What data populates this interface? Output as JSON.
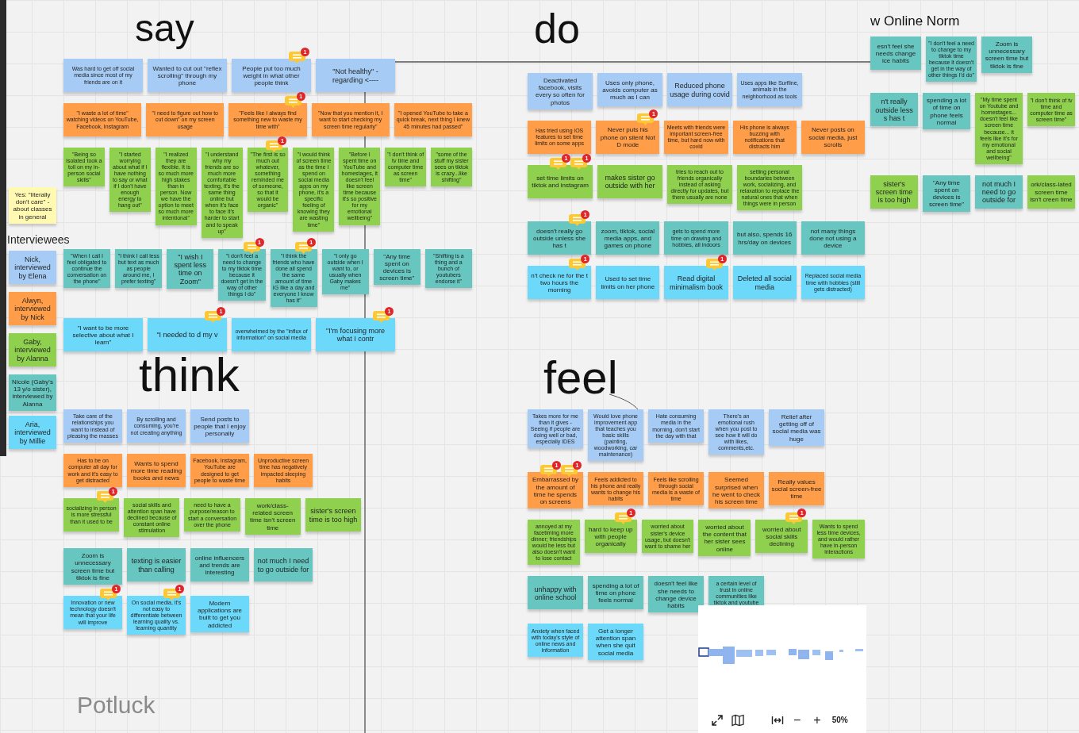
{
  "sections": [
    {
      "title": "say",
      "notes": [
        {
          "text": "Was hard to get off social media since most of my friends are on it",
          "color": "#a6ccf5"
        },
        {
          "text": "Wanted to cut out \"reflex scrolling\" through my phone",
          "color": "#a6ccf5"
        },
        {
          "text": "People put too much weight in what other people think",
          "color": "#a6ccf5",
          "comments": [
            "1"
          ]
        },
        {
          "text": "\"Not healthy\" - regarding <----",
          "color": "#a6ccf5"
        },
        {
          "text": "\"I waste a lot of time\" watching videos on YouTube, Facebook, Instagram",
          "color": "#ff9d48"
        },
        {
          "text": "\"I need to figure out how to cut down\" on my screen usage",
          "color": "#ff9d48"
        },
        {
          "text": "\"Feels like I always find something new to waste my time with\"",
          "color": "#ff9d48",
          "comments": [
            "1"
          ]
        },
        {
          "text": "\"Now that you mention it, I want to start checking my screen time regularly\"",
          "color": "#ff9d48"
        },
        {
          "text": "\"I opened YouTube to take a quick break, next thing I knew 45 minutes had passed\"",
          "color": "#ff9d48"
        },
        {
          "text": "\"Being so isolated took a toll on my in-person social skills\"",
          "color": "#8fd14f"
        },
        {
          "text": "\"I started worrying about what if I have nothing to say or what if I don't have enough energy to hang out\"",
          "color": "#8fd14f"
        },
        {
          "text": "\"I realized they are flexible. It is so much more high stakes than in person. Now we have the option to meet so much more intentional\"",
          "color": "#8fd14f"
        },
        {
          "text": "\"I understand why my friends are so much more comfortable texting, it's the same thing online but when it's face to face it's harder to start and to speak up\"",
          "color": "#8fd14f"
        },
        {
          "text": "\"The first is so much out whatever, something reminded me of someone, so that it would be organic\"",
          "color": "#8fd14f",
          "comments": [
            "1"
          ]
        },
        {
          "text": "\"I would think of screen time as the time I spend on social media apps on my phone, it's a specific feeling of knowing they are wasting time\"",
          "color": "#8fd14f"
        },
        {
          "text": "\"Before I spent time on YouTube and homestages, it doesn't feel like screen time because it's so positive for my emotional wellbeing\"",
          "color": "#8fd14f"
        },
        {
          "text": "\"I don't think of tv time and computer time as screen time\"",
          "color": "#8fd14f"
        },
        {
          "text": "\"some of the stuff my sister sees on tiktok is crazy...like shifting\"",
          "color": "#8fd14f"
        },
        {
          "text": "\"When I call I feel obligated to continue the conversation on the phone\"",
          "color": "#67c6c0"
        },
        {
          "text": "\"I think I call less but text as much as people around me, I prefer texting\"",
          "color": "#67c6c0"
        },
        {
          "text": "\"I wish I spent less time on Zoom\"",
          "color": "#67c6c0"
        },
        {
          "text": "\"I don't feel a need to change to my tiktok time because it doesn't get in the way of other things I do\"",
          "color": "#67c6c0",
          "comments": [
            "1"
          ]
        },
        {
          "text": "\"I think the friends who have done all spend the same amount of time IG like a day and everyone I know has it\"",
          "color": "#67c6c0",
          "comments": [
            "1"
          ]
        },
        {
          "text": "\"I only go outside when I want to, or usually when Gaby makes me\"",
          "color": "#67c6c0"
        },
        {
          "text": "\"Any time spent on devices is screen time\"",
          "color": "#67c6c0"
        },
        {
          "text": "\"Shifting is a thing and a bunch of youtubers endorse it\"",
          "color": "#67c6c0"
        },
        {
          "text": "\"I want to be more selective about what I learn\"",
          "color": "#6cd8fa"
        },
        {
          "text": "\"I needed to d my v",
          "color": "#6cd8fa",
          "comments": [
            "1"
          ]
        },
        {
          "text": "overwhelmed by the \"influx of information\" on social media",
          "color": "#6cd8fa"
        },
        {
          "text": "\"I'm focusing more what I contr",
          "color": "#6cd8fa",
          "comments": [
            "1"
          ]
        }
      ]
    },
    {
      "title": "do",
      "notes": [
        {
          "text": "Deactivated facebook, visits every so often for photos",
          "color": "#a6ccf5"
        },
        {
          "text": "Uses only phone, avoids computer as much as I can",
          "color": "#a6ccf5"
        },
        {
          "text": "Reduced phone usage during covid",
          "color": "#a6ccf5"
        },
        {
          "text": "Uses apps like Surfline, animals in the neighborhood as tools",
          "color": "#a6ccf5"
        },
        {
          "text": "Has tried using iOS features to set time limits on some apps",
          "color": "#ff9d48"
        },
        {
          "text": "Never puts his phone on silent Not D mode",
          "color": "#ff9d48",
          "comments": [
            "1"
          ]
        },
        {
          "text": "Meets with friends were important screen-free time, but hard now with covid",
          "color": "#ff9d48"
        },
        {
          "text": "His phone is always buzzing with notifications that distracts him",
          "color": "#ff9d48"
        },
        {
          "text": "Never posts on social media, just scrolls",
          "color": "#ff9d48"
        },
        {
          "text": "set time limits on tiktok and instagram",
          "color": "#8fd14f",
          "comments": [
            "1",
            "1"
          ]
        },
        {
          "text": "makes sister go outside with her",
          "color": "#8fd14f"
        },
        {
          "text": "tries to reach out to friends organically instead of asking directly for updates, but there usually are none",
          "color": "#8fd14f"
        },
        {
          "text": "setting personal boundaries between work, socializing, and relaxation to replace the natural ones that when things were in person",
          "color": "#8fd14f"
        },
        {
          "text": "doesn't really go outside unless she has t",
          "color": "#67c6c0",
          "comments": [
            "1"
          ]
        },
        {
          "text": "zoom, tiktok, social media apps, and games on phone",
          "color": "#67c6c0"
        },
        {
          "text": "gets to spend more time on drawing and hobbies, all indoors",
          "color": "#67c6c0"
        },
        {
          "text": "but also, spends 16 hrs/day on devices",
          "color": "#67c6c0"
        },
        {
          "text": "not many things done not using a device",
          "color": "#67c6c0"
        },
        {
          "text": "n't check ne for the t two hours the morning",
          "color": "#6cd8fa",
          "comments": [
            "1"
          ]
        },
        {
          "text": "Used to set time limits on her phone",
          "color": "#6cd8fa"
        },
        {
          "text": "Read digital minimalism book",
          "color": "#6cd8fa",
          "comments": [
            "1"
          ]
        },
        {
          "text": "Deleted all social media",
          "color": "#6cd8fa"
        },
        {
          "text": "Replaced social media time with hobbies (still gets distracted)",
          "color": "#6cd8fa"
        }
      ]
    },
    {
      "title": "w Online Norm",
      "notes": [
        {
          "text": "esn't feel she needs change ice habits",
          "color": "#67c6c0"
        },
        {
          "text": "\"I don't feel a need to change to my tiktok time because it doesn't get in the way of other things I'd do\"",
          "color": "#67c6c0"
        },
        {
          "text": "Zoom is unnecessary screen time but tiktok is fine",
          "color": "#67c6c0"
        },
        {
          "text": "n't really outside less s has t",
          "color": "#67c6c0"
        },
        {
          "text": "spending a lot of time on phone feels normal",
          "color": "#67c6c0"
        },
        {
          "text": "\"My time spent on Youtube and homestages... doesn't feel like screen time because... it feels like it's for my emotional and social wellbeing\"",
          "color": "#8fd14f"
        },
        {
          "text": "\"I don't think of tv time and computer time as screen time\"",
          "color": "#8fd14f"
        },
        {
          "text": "sister's screen time is too high",
          "color": "#8fd14f"
        },
        {
          "text": "\"Any time spent on devices is screen time\"",
          "color": "#67c6c0"
        },
        {
          "text": "not much I need to go outside for",
          "color": "#67c6c0"
        },
        {
          "text": "ork/class-lated screen time isn't creen time",
          "color": "#8fd14f"
        }
      ]
    },
    {
      "title": "think",
      "notes": [
        {
          "text": "Take care of the relationships you want to instead of pleasing the masses",
          "color": "#a6ccf5"
        },
        {
          "text": "By scrolling and consuming, you're not creating anything",
          "color": "#a6ccf5"
        },
        {
          "text": "Send posts to people that I enjoy personally",
          "color": "#a6ccf5"
        },
        {
          "text": "Has to be on computer all day for work and it's easy to get distracted",
          "color": "#ff9d48"
        },
        {
          "text": "Wants to spend more time reading books and news",
          "color": "#ff9d48"
        },
        {
          "text": "Facebook, Instagram, YouTube are designed to get people to waste time",
          "color": "#ff9d48"
        },
        {
          "text": "Unproductive screen time has negatively impacted sleeping habits",
          "color": "#ff9d48"
        },
        {
          "text": "socializing in person is more stressful than it used to be",
          "color": "#8fd14f",
          "comments": [
            "1"
          ]
        },
        {
          "text": "social skills and attention span have declined because of constant online stimulation",
          "color": "#8fd14f"
        },
        {
          "text": "need to have a purpose/reason to start a conversation over the phone",
          "color": "#8fd14f"
        },
        {
          "text": "work/class-related screen time isn't screen time",
          "color": "#8fd14f"
        },
        {
          "text": "sister's screen time is too high",
          "color": "#8fd14f"
        },
        {
          "text": "Zoom is unnecessary screen time but tiktok is fine",
          "color": "#67c6c0"
        },
        {
          "text": "texting is easier than calling",
          "color": "#67c6c0"
        },
        {
          "text": "online influencers and trends are interesting",
          "color": "#67c6c0"
        },
        {
          "text": "not much I need to go outside for",
          "color": "#67c6c0"
        },
        {
          "text": "Innovation or new technology doesn't mean that your life will improve",
          "color": "#6cd8fa",
          "comments": [
            "1"
          ]
        },
        {
          "text": "On social media, it's not easy to differentiate between learning quality vs. learning quantity",
          "color": "#6cd8fa",
          "comments": [
            "1"
          ]
        },
        {
          "text": "Modern applications are built to get you addicted",
          "color": "#6cd8fa"
        }
      ]
    },
    {
      "title": "feel",
      "notes": [
        {
          "text": "Takes more for me than it gives - Seeing if people are doing well or bad, especially IDES",
          "color": "#a6ccf5"
        },
        {
          "text": "Would love phone improvement app that teaches you basic skills (painting, woodworking, car maintenance)",
          "color": "#a6ccf5"
        },
        {
          "text": "Hate consuming media in the morning, don't start the day with that",
          "color": "#a6ccf5"
        },
        {
          "text": "There's an emotional rush when you post to see how it will do with likes, comments,etc.",
          "color": "#a6ccf5"
        },
        {
          "text": "Relief after getting off of social media was huge",
          "color": "#a6ccf5"
        },
        {
          "text": "Embarrassed by the amount of time he spends on screens",
          "color": "#ff9d48",
          "comments": [
            "1",
            "1"
          ]
        },
        {
          "text": "Feels addicted to his phone and really wants to change his habits",
          "color": "#ff9d48"
        },
        {
          "text": "Feels like scrolling through social media is a waste of time",
          "color": "#ff9d48"
        },
        {
          "text": "Seemed surprised when he went to check his screen time",
          "color": "#ff9d48"
        },
        {
          "text": "Really values social screen-free time",
          "color": "#ff9d48"
        },
        {
          "text": "annoyed at my facetiming more dinner; friendships would be less but also doesn't want to lose contact",
          "color": "#8fd14f"
        },
        {
          "text": "hard to keep up with people organically",
          "color": "#8fd14f",
          "comments": [
            "1"
          ]
        },
        {
          "text": "worried about sister's device usage, but doesn't want to shame her",
          "color": "#8fd14f"
        },
        {
          "text": "worried about the content that her sister sees online",
          "color": "#8fd14f"
        },
        {
          "text": "worried about social skills declining",
          "color": "#8fd14f",
          "comments": [
            "1"
          ]
        },
        {
          "text": "Wants to spend less time devices, and would rather have in-person interactions",
          "color": "#8fd14f"
        },
        {
          "text": "unhappy with online school",
          "color": "#67c6c0"
        },
        {
          "text": "spending a lot of time on phone feels normal",
          "color": "#67c6c0"
        },
        {
          "text": "doesn't feel like she needs to change device habits",
          "color": "#67c6c0"
        },
        {
          "text": "a certain level of trust in online communities like tiktok and youtube",
          "color": "#67c6c0"
        },
        {
          "text": "Anxiety when faced with today's style of online news and information",
          "color": "#6cd8fa"
        },
        {
          "text": "Get a longer attention span when she quit social media",
          "color": "#6cd8fa"
        }
      ]
    }
  ],
  "side_note": {
    "text": "Yes: \"literally don't care\" - about classes in general",
    "color": "#fff9b1"
  },
  "legend": {
    "title": "Interviewees",
    "notes": [
      {
        "text": "Nick, interviewed by Elena",
        "color": "#a6ccf5"
      },
      {
        "text": "Alwyn, interviewed by Nick",
        "color": "#ff9d48"
      },
      {
        "text": "Gaby, interviewed by Alanna",
        "color": "#8fd14f"
      },
      {
        "text": "Nicole (Gaby's 13 y/o sister), interviewed by Alanna",
        "color": "#67c6c0"
      },
      {
        "text": "Aria, interviewed by Millie",
        "color": "#6cd8fa"
      }
    ]
  },
  "board_name": "Potluck",
  "toolbar": {
    "zoom_out": "−",
    "zoom_in": "+",
    "zoom_level": "50%"
  }
}
